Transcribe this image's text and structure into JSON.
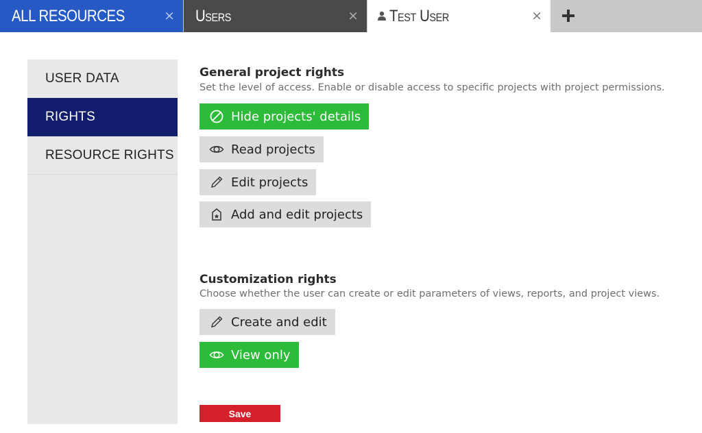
{
  "tabs": [
    {
      "label": "All Resources",
      "close": "×"
    },
    {
      "label": "Users",
      "close": "×"
    },
    {
      "label": "Test User",
      "close": "×"
    }
  ],
  "add_tab": {
    "icon": "plus-icon"
  },
  "sidebar": {
    "items": [
      {
        "label": "USER DATA",
        "active": false
      },
      {
        "label": "RIGHTS",
        "active": true
      },
      {
        "label": "RESOURCE RIGHTS",
        "active": false
      }
    ]
  },
  "general": {
    "title": "General project rights",
    "desc": "Set the level of access. Enable or disable access to specific projects with project permissions.",
    "options": [
      {
        "label": "Hide projects' details",
        "icon": "forbidden-icon",
        "selected": true
      },
      {
        "label": "Read projects",
        "icon": "eye-icon",
        "selected": false
      },
      {
        "label": "Edit projects",
        "icon": "pencil-icon",
        "selected": false
      },
      {
        "label": "Add and edit projects",
        "icon": "house-star-icon",
        "selected": false
      }
    ]
  },
  "customization": {
    "title": "Customization rights",
    "desc": "Choose whether the user can create or edit parameters of views, reports, and project views.",
    "options": [
      {
        "label": "Create and edit",
        "icon": "pencil-icon",
        "selected": false
      },
      {
        "label": "View only",
        "icon": "eye-icon",
        "selected": true
      }
    ]
  },
  "save": {
    "label": "Save"
  },
  "colors": {
    "tab_active_blue": "#2659c4",
    "tab_dark": "#4a4a4a",
    "sidebar_active": "#131d6e",
    "selected_green": "#2dbb3a",
    "save_red": "#d4202a"
  }
}
